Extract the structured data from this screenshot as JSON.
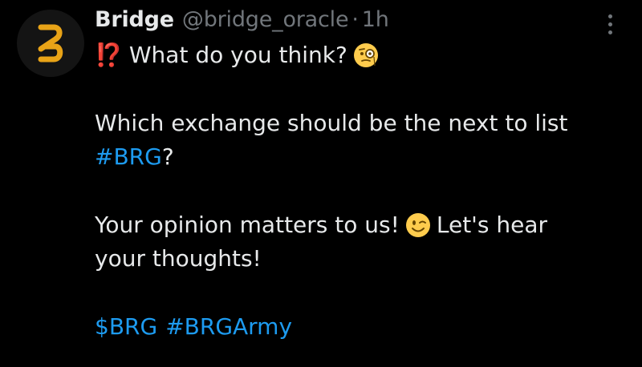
{
  "author": {
    "name": "Bridge",
    "handle": "@bridge_oracle",
    "separator": "·",
    "time": "1h",
    "avatar_icon": "bridge-logo-icon",
    "avatar_color": "#e8a317"
  },
  "tweet": {
    "line1_prefix": "⁉️",
    "line1_text": "What do you think?",
    "line1_emoji": "face-with-monocle-emoji",
    "line2_text": "Which exchange should be the next to list",
    "line3_hashtag": "#BRG",
    "line3_suffix": "?",
    "line4_text_a": "Your opinion matters to us!",
    "line4_emoji": "winking-face-emoji",
    "line4_text_b": "Let's hear",
    "line5_text": "your thoughts!",
    "tags": [
      "$BRG",
      "#BRGArmy"
    ]
  },
  "more_icon": "more-options-icon",
  "colors": {
    "background": "#000000",
    "text": "#e7e9ea",
    "muted": "#71767b",
    "link": "#1d9bf0"
  }
}
